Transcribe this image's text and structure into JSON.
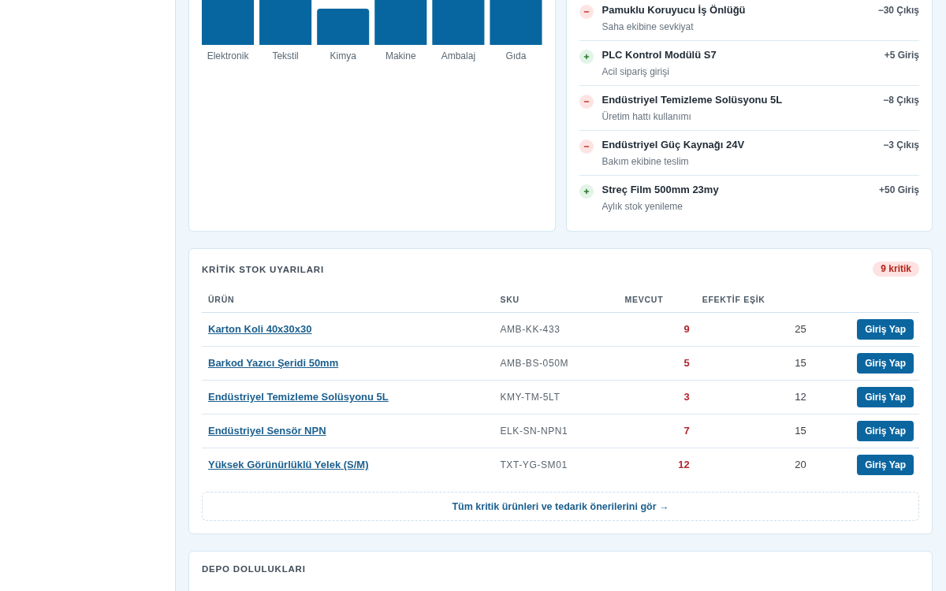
{
  "category_chart": {
    "categories": [
      "Elektronik",
      "Tekstil",
      "Kimya",
      "Makine",
      "Ambalaj",
      "Gıda"
    ]
  },
  "stock_movements": [
    {
      "kind": "out",
      "product": "Pamuklu Koruyucu İş Önlüğü",
      "note": "Saha ekibine sevkiyat",
      "quantity": "−30 Çıkış"
    },
    {
      "kind": "in",
      "product": "PLC Kontrol Modülü S7",
      "note": "Acil sipariş girişi",
      "quantity": "+5 Giriş"
    },
    {
      "kind": "out",
      "product": "Endüstriyel Temizleme Solüsyonu 5L",
      "note": "Üretim hattı kullanımı",
      "quantity": "−8 Çıkış"
    },
    {
      "kind": "out",
      "product": "Endüstriyel Güç Kaynağı 24V",
      "note": "Bakım ekibine teslim",
      "quantity": "−3 Çıkış"
    },
    {
      "kind": "in",
      "product": "Streç Film 500mm 23my",
      "note": "Aylık stok yenileme",
      "quantity": "+50 Giriş"
    }
  ],
  "critical_stock": {
    "title": "KRİTİK STOK UYARILARI",
    "badge": "9 kritik",
    "columns": [
      "ÜRÜN",
      "SKU",
      "MEVCUT",
      "EFEKTİF EŞİK"
    ],
    "rows": [
      {
        "product": "Karton Koli 40x30x30",
        "sku": "AMB-KK-433",
        "available": "9",
        "threshold": "25",
        "action": "Giriş Yap"
      },
      {
        "product": "Barkod Yazıcı Şeridi 50mm",
        "sku": "AMB-BS-050M",
        "available": "5",
        "threshold": "15",
        "action": "Giriş Yap"
      },
      {
        "product": "Endüstriyel Temizleme Solüsyonu 5L",
        "sku": "KMY-TM-5LT",
        "available": "3",
        "threshold": "12",
        "action": "Giriş Yap"
      },
      {
        "product": "Endüstriyel Sensör NPN",
        "sku": "ELK-SN-NPN1",
        "available": "7",
        "threshold": "15",
        "action": "Giriş Yap"
      },
      {
        "product": "Yüksek Görünürlüklü Yelek (S/M)",
        "sku": "TXT-YG-SM01",
        "available": "12",
        "threshold": "20",
        "action": "Giriş Yap"
      }
    ],
    "footer_link": "Tüm kritik ürünleri ve tedarik önerilerini gör →"
  },
  "warehouse_occupancy": {
    "title": "DEPO DOLULUKLARI"
  }
}
